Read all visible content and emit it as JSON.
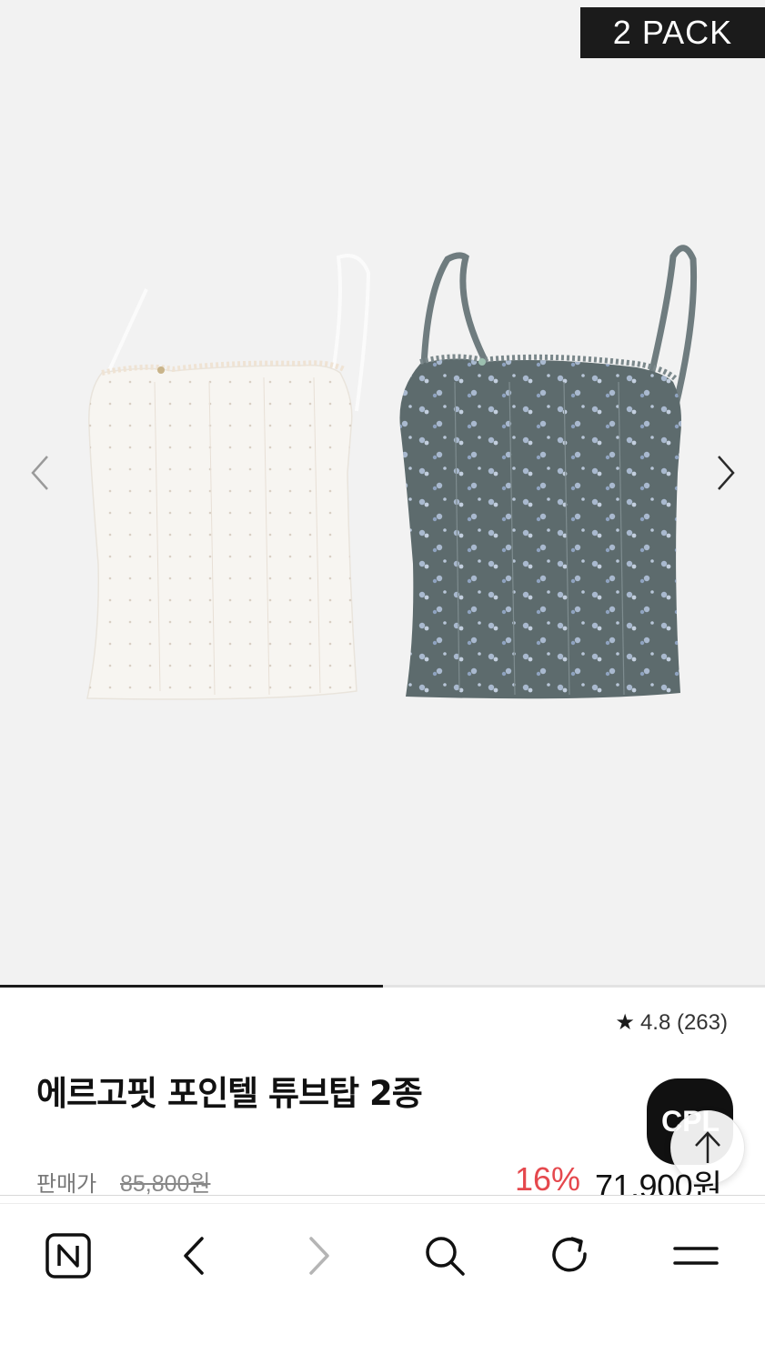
{
  "gallery": {
    "badge": "2 PACK",
    "prev_label": "previous image",
    "next_label": "next image",
    "progress": 0.5
  },
  "product": {
    "rating_star": "★",
    "rating": "4.8 (263)",
    "title": "에르고핏 포인텔 튜브탑 2종",
    "price_label": "판매가",
    "original_price": "85,800원",
    "discount": "16%",
    "sale_price": "71,900원",
    "chat_text": "CPL"
  },
  "toolbar": {
    "items": [
      "home-n-icon",
      "back-icon",
      "forward-icon",
      "search-icon",
      "refresh-icon",
      "menu-icon"
    ]
  },
  "colors": {
    "accent_discount": "#e5484d",
    "badge_bg": "#1b1b1b",
    "gallery_bg": "#f2f2f2",
    "white_top": "#f7f5f1",
    "gray_top": "#5d6b6d"
  }
}
